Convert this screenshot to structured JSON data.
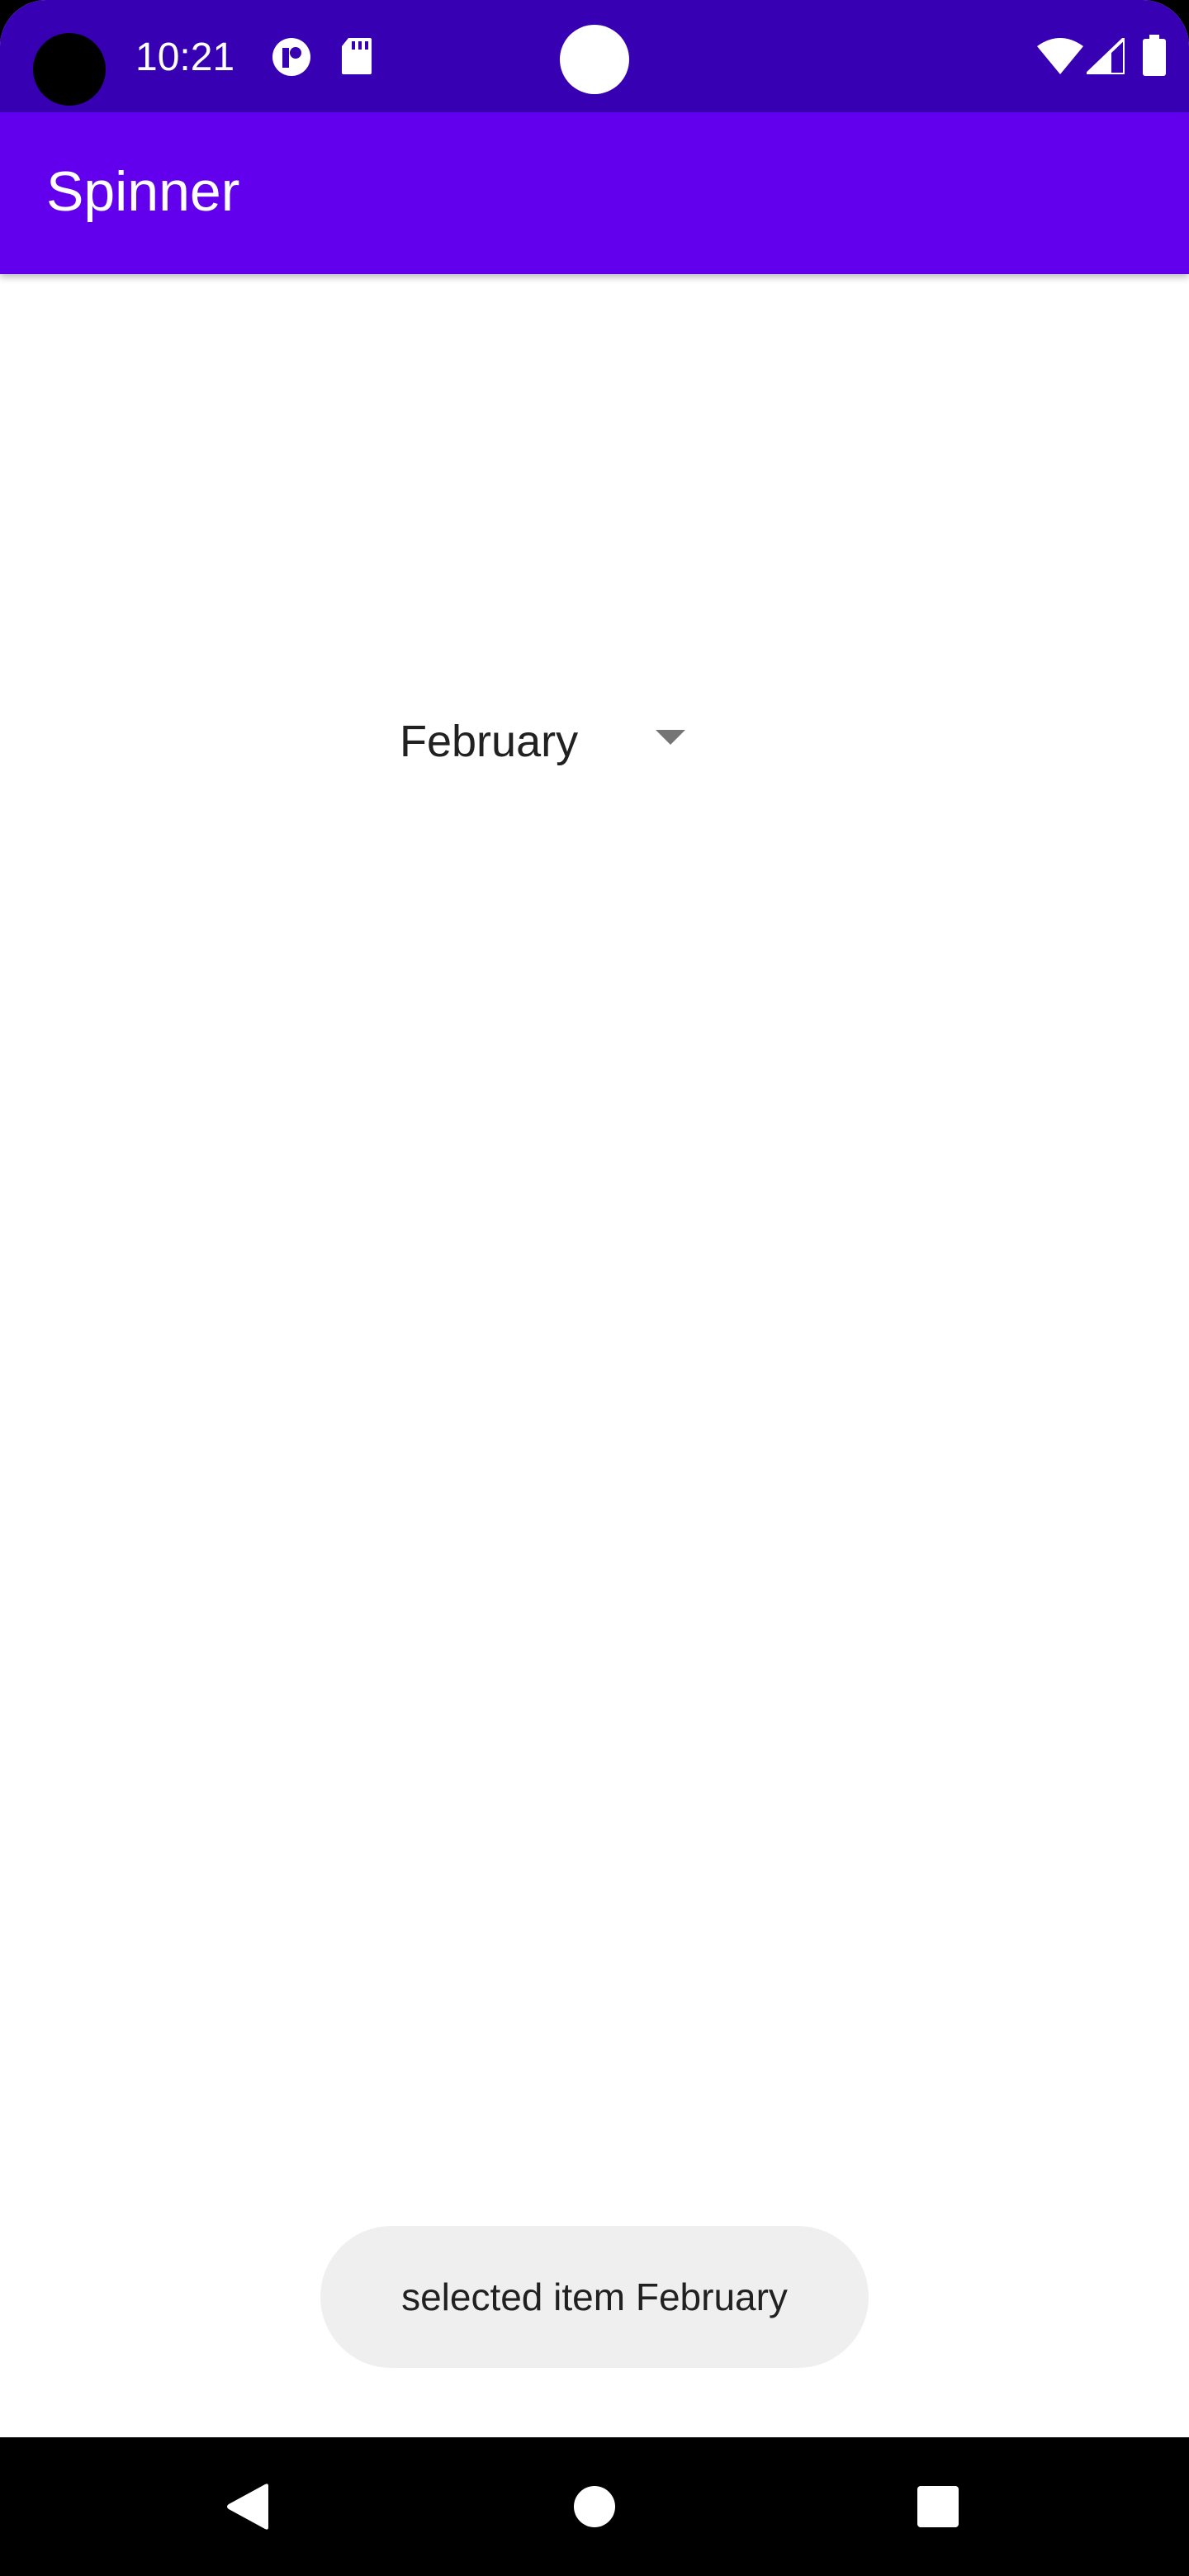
{
  "status_bar": {
    "time": "10:21",
    "icons_left": [
      "app-notification-icon",
      "sd-card-icon"
    ],
    "icons_right": [
      "wifi-icon",
      "cell-signal-icon",
      "battery-icon"
    ],
    "background": "#3700b3"
  },
  "app_bar": {
    "title": "Spinner",
    "background": "#6200ee"
  },
  "spinner": {
    "selected_value": "February"
  },
  "toast": {
    "message": "selected item February"
  },
  "nav_bar": {
    "buttons": [
      "back-icon",
      "home-icon",
      "recents-icon"
    ]
  }
}
